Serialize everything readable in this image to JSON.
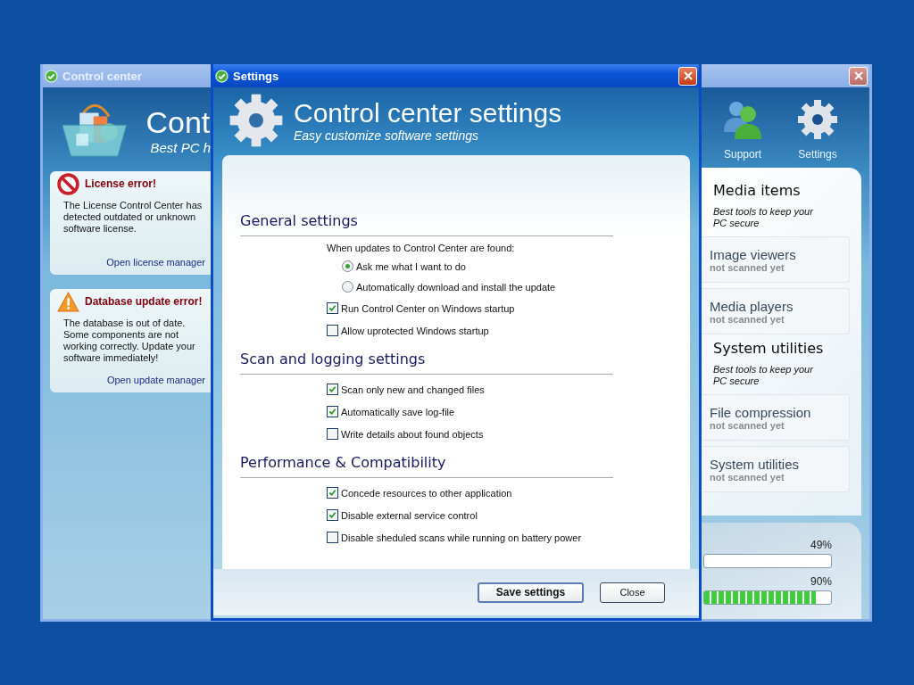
{
  "main_window": {
    "title": "Control center",
    "header_title": "Cont",
    "header_subtitle": "Best PC h",
    "alerts": [
      {
        "kind": "error",
        "title": "License error!",
        "message": "The License Control Center has detected outdated or unknown software license.",
        "link": "Open license manager"
      },
      {
        "kind": "warning",
        "title": "Database update error!",
        "message": "The database is out of date. Some components are not working correctly. Update your software immediately!",
        "link": "Open update manager"
      }
    ],
    "toolbar": [
      {
        "kind": "support",
        "label": "Support"
      },
      {
        "kind": "settings",
        "label": "Settings"
      }
    ],
    "groups": [
      {
        "title": "Media items",
        "subtitle": "Best tools to keep your PC secure",
        "items": [
          {
            "name": "Image viewers",
            "status": "not scanned yet"
          },
          {
            "name": "Media players",
            "status": "not scanned yet"
          }
        ]
      },
      {
        "title": "System utilities",
        "subtitle": "Best tools to keep your PC secure",
        "items": [
          {
            "name": "File compression",
            "status": "not scanned yet"
          },
          {
            "name": "System utilities",
            "status": "not scanned yet"
          }
        ]
      }
    ],
    "progress": [
      {
        "reading": "49%",
        "level": 0
      },
      {
        "reading": "90%",
        "level": 0.88
      }
    ]
  },
  "settings_dialog": {
    "title": "Settings",
    "header_title": "Control center settings",
    "header_subtitle": "Easy customize software settings",
    "sections": [
      {
        "title": "General settings",
        "options": [
          {
            "kind": "label",
            "label": "When updates to Control Center are found:"
          },
          {
            "kind": "radio",
            "label": "Ask me what I want to do",
            "selected": true
          },
          {
            "kind": "radio",
            "label": "Automatically download and install the update",
            "selected": false
          },
          {
            "kind": "checkbox",
            "label": "Run Control Center on Windows startup",
            "checked": true
          },
          {
            "kind": "checkbox",
            "label": "Allow uprotected Windows startup",
            "checked": false
          }
        ]
      },
      {
        "title": "Scan and logging settings",
        "options": [
          {
            "kind": "checkbox",
            "label": "Scan only new and changed files",
            "checked": true
          },
          {
            "kind": "checkbox",
            "label": "Automatically save log-file",
            "checked": true
          },
          {
            "kind": "checkbox",
            "label": "Write details about found objects",
            "checked": false
          }
        ]
      },
      {
        "title": "Performance & Compatibility",
        "options": [
          {
            "kind": "checkbox",
            "label": "Concede resources to other application",
            "checked": true
          },
          {
            "kind": "checkbox",
            "label": "Disable external service control",
            "checked": true
          },
          {
            "kind": "checkbox",
            "label": "Disable sheduled scans while running on battery power",
            "checked": false
          }
        ]
      }
    ],
    "buttons": [
      {
        "label": "Save settings",
        "default": true
      },
      {
        "label": "Close",
        "default": false
      }
    ]
  }
}
